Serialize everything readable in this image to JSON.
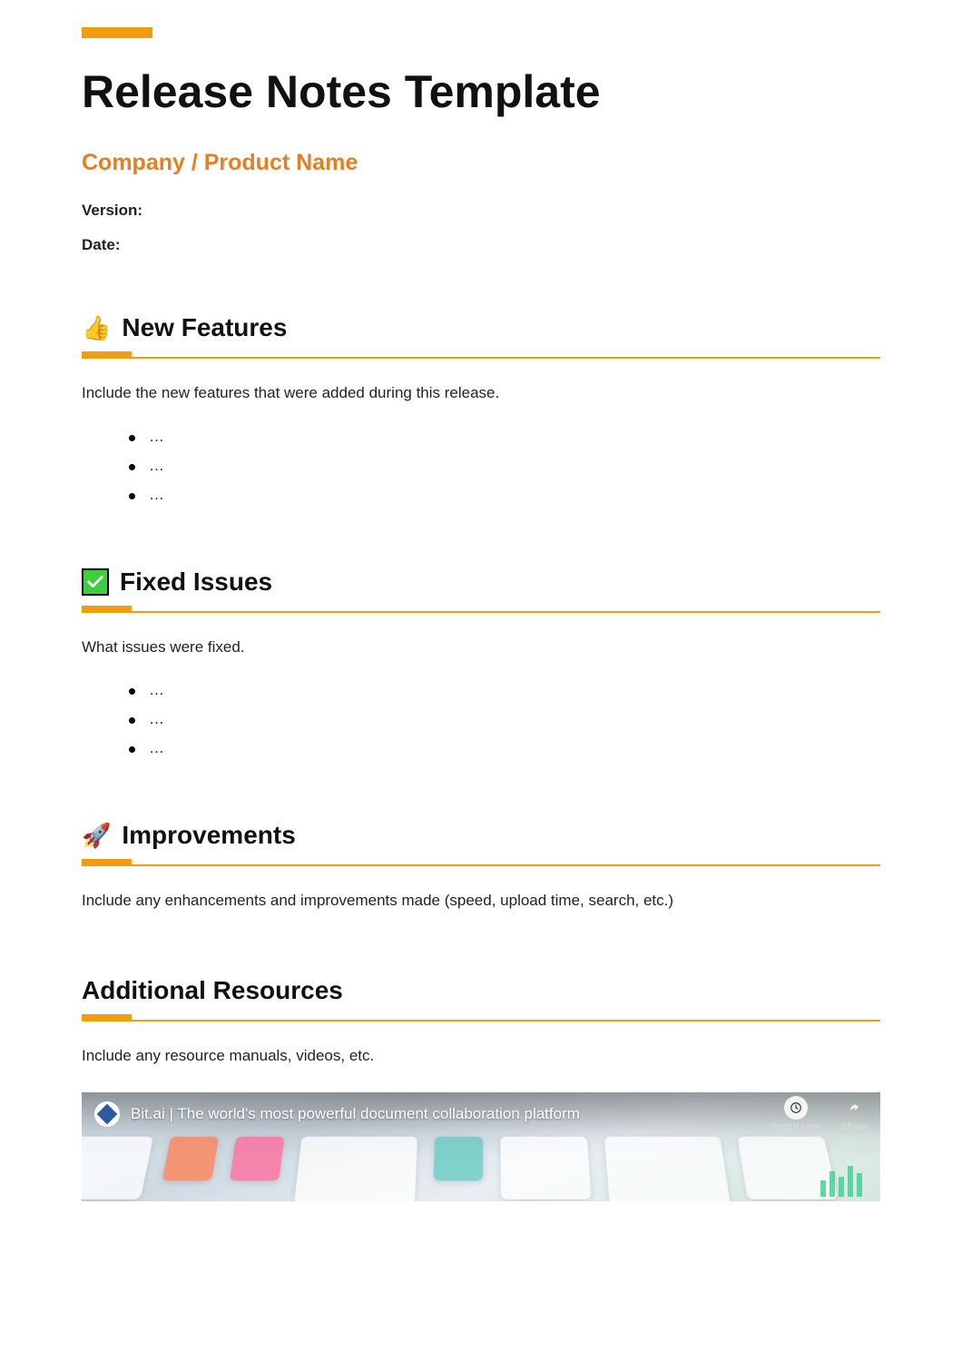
{
  "colors": {
    "accent": "#f39c12",
    "subtitle": "#e67e22"
  },
  "header": {
    "title": "Release Notes Template",
    "subtitle": "Company / Product Name",
    "version_label": "Version:",
    "date_label": "Date:"
  },
  "sections": {
    "new_features": {
      "icon": "thumbs-up",
      "heading": "New Features",
      "body": "Include the new features that were added during this release.",
      "bullets": [
        "…",
        "…",
        "…"
      ]
    },
    "fixed_issues": {
      "icon": "green-check",
      "heading": "Fixed Issues",
      "body": "What issues were fixed.",
      "bullets": [
        "…",
        "…",
        "…"
      ]
    },
    "improvements": {
      "icon": "rocket",
      "heading": "Improvements",
      "body": "Include any enhancements and improvements made (speed, upload time, search, etc.)"
    },
    "additional_resources": {
      "heading": "Additional Resources",
      "body": "Include any resource manuals, videos, etc."
    }
  },
  "video": {
    "title": "Bit.ai | The world's most powerful document collaboration platform",
    "watch_later_label": "Watch later",
    "share_label": "Share"
  }
}
